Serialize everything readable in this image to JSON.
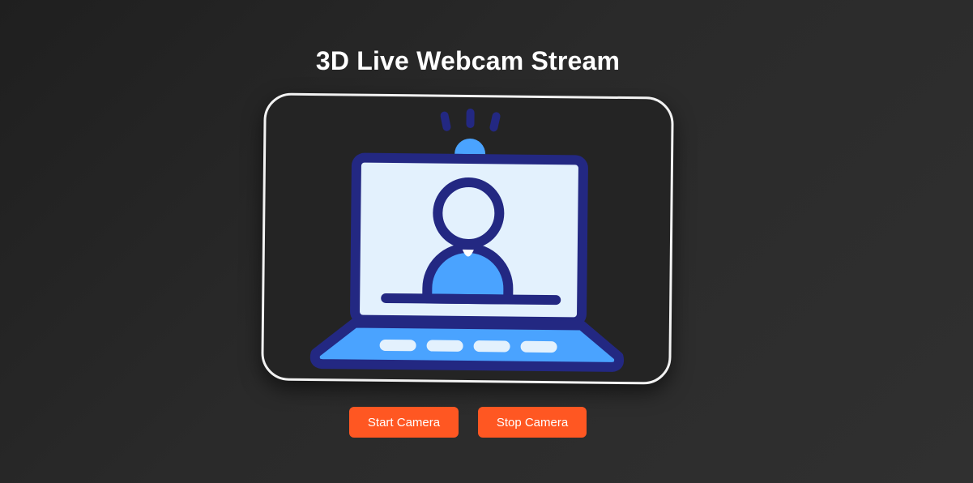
{
  "page": {
    "title": "3D Live Webcam Stream"
  },
  "video": {
    "placeholder_icon": "laptop-webcam-user-icon",
    "colors": {
      "frame_border": "#f2f2f2",
      "navy": "#232882",
      "blue": "#4aa3ff",
      "screen": "#e3f1fd"
    }
  },
  "controls": {
    "start_label": "Start Camera",
    "stop_label": "Stop Camera",
    "button_color": "#ff5722"
  }
}
